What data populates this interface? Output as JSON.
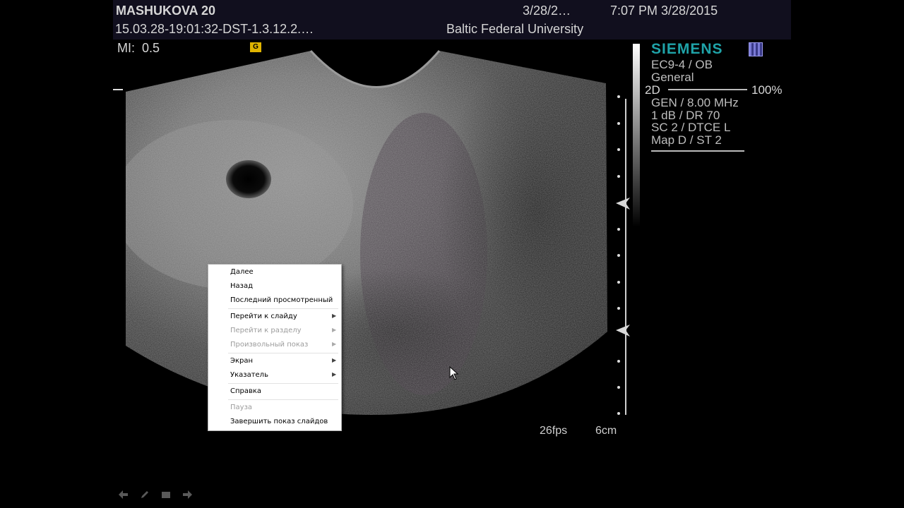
{
  "header": {
    "patient_name": "MASHUKOVA 20",
    "date_short": "3/28/2…",
    "time_date": "7:07 PM 3/28/2015",
    "study_id": "15.03.28-19:01:32-DST-1.3.12.2.…",
    "institution": "Baltic Federal University"
  },
  "mi": {
    "label": "MI:",
    "value": "0.5"
  },
  "scanner": {
    "brand": "SIEMENS",
    "brand_color": "#1fa3a8",
    "probe": "EC9-4 / OB",
    "preset": "General",
    "mode": "2D",
    "gain_percent": "100%",
    "frequency": "GEN / 8.00 MHz",
    "dynamic_range": "1 dB / DR 70",
    "compounding": "SC 2 / DTCE L",
    "map": "Map D / ST 2"
  },
  "status": {
    "fps": "26fps",
    "depth": "6cm"
  },
  "context_menu": {
    "items": [
      {
        "label": "Далее",
        "disabled": false,
        "submenu": false
      },
      {
        "label": "Назад",
        "disabled": false,
        "submenu": false
      },
      {
        "label": "Последний просмотренный",
        "disabled": false,
        "submenu": false
      },
      {
        "label": "Перейти к слайду",
        "disabled": false,
        "submenu": true
      },
      {
        "label": "Перейти к разделу",
        "disabled": true,
        "submenu": true
      },
      {
        "label": "Произвольный показ",
        "disabled": true,
        "submenu": true
      },
      {
        "label": "Экран",
        "disabled": false,
        "submenu": true
      },
      {
        "label": "Указатель",
        "disabled": false,
        "submenu": true
      },
      {
        "label": "Справка",
        "disabled": false,
        "submenu": false
      },
      {
        "label": "Пауза",
        "disabled": true,
        "submenu": false
      },
      {
        "label": "Завершить показ слайдов",
        "disabled": false,
        "submenu": false
      }
    ]
  },
  "slideshow_nav": [
    "previous-slide-icon",
    "pen-icon",
    "menu-icon",
    "next-slide-icon"
  ]
}
